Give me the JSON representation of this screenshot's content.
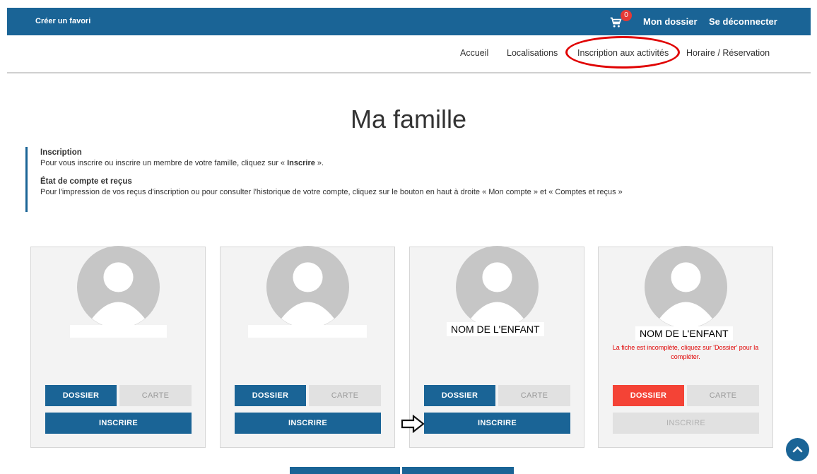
{
  "topbar": {
    "favorite_label": "Créer un favori",
    "cart_count": "0",
    "my_file": "Mon dossier",
    "logout": "Se déconnecter"
  },
  "nav": {
    "items": [
      "Accueil",
      "Localisations",
      "Inscription aux activités",
      "Horaire / Réservation"
    ]
  },
  "page": {
    "title": "Ma famille"
  },
  "info": {
    "inscription_heading": "Inscription",
    "inscription_text_before": "Pour vous inscrire ou inscrire un membre de votre famille, cliquez sur « ",
    "inscription_text_bold": "Inscrire",
    "inscription_text_after": " ».",
    "account_heading": "État de compte et reçus",
    "account_text": "Pour l'impression de vos reçus d'inscription ou pour consulter l'historique de votre compte, cliquez sur le bouton en haut à droite « Mon compte » et « Comptes et reçus »"
  },
  "cards": [
    {
      "name": "",
      "warning": "",
      "dossier_label": "DOSSIER",
      "carte_label": "CARTE",
      "inscrire_label": "INSCRIRE"
    },
    {
      "name": "",
      "warning": "",
      "dossier_label": "DOSSIER",
      "carte_label": "CARTE",
      "inscrire_label": "INSCRIRE"
    },
    {
      "name": "NOM DE L'ENFANT",
      "warning": "",
      "dossier_label": "DOSSIER",
      "carte_label": "CARTE",
      "inscrire_label": "INSCRIRE"
    },
    {
      "name": "NOM DE L'ENFANT",
      "warning": "La fiche est incomplète, cliquez sur 'Dossier' pour la compléter.",
      "dossier_label": "DOSSIER",
      "carte_label": "CARTE",
      "inscrire_label": "INSCRIRE"
    }
  ],
  "colors": {
    "brand": "#1a6496",
    "danger": "#f44336",
    "highlight_circle": "#e00000"
  }
}
